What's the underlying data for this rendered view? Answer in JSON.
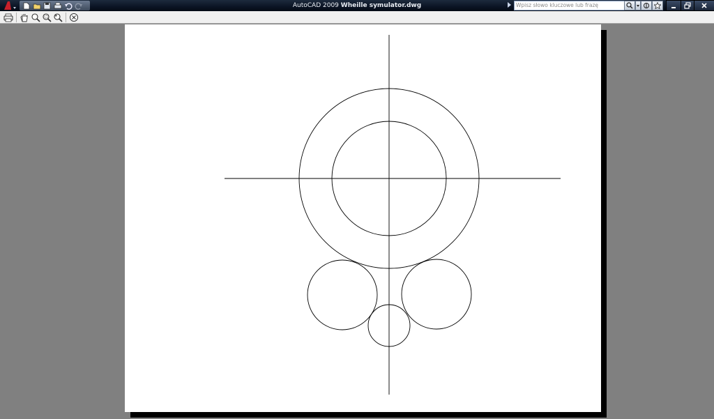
{
  "window": {
    "app_name": "AutoCAD 2009",
    "file_name": "Wheille symulator.dwg"
  },
  "quick_access": {
    "items": [
      "new-icon",
      "open-icon",
      "save-icon",
      "plot-icon",
      "undo-icon",
      "redo-icon"
    ]
  },
  "search": {
    "placeholder": "Wpisz słowo kluczowe lub frazę"
  },
  "preview_toolbar": {
    "items": [
      "print-icon",
      "pan-icon",
      "zoom-icon",
      "zoom-window-icon",
      "zoom-original-icon",
      "close-preview-icon"
    ]
  },
  "colors": {
    "background": "#808080",
    "paper": "#ffffff",
    "linework": "#000000",
    "titlebar": "#0b1424"
  }
}
